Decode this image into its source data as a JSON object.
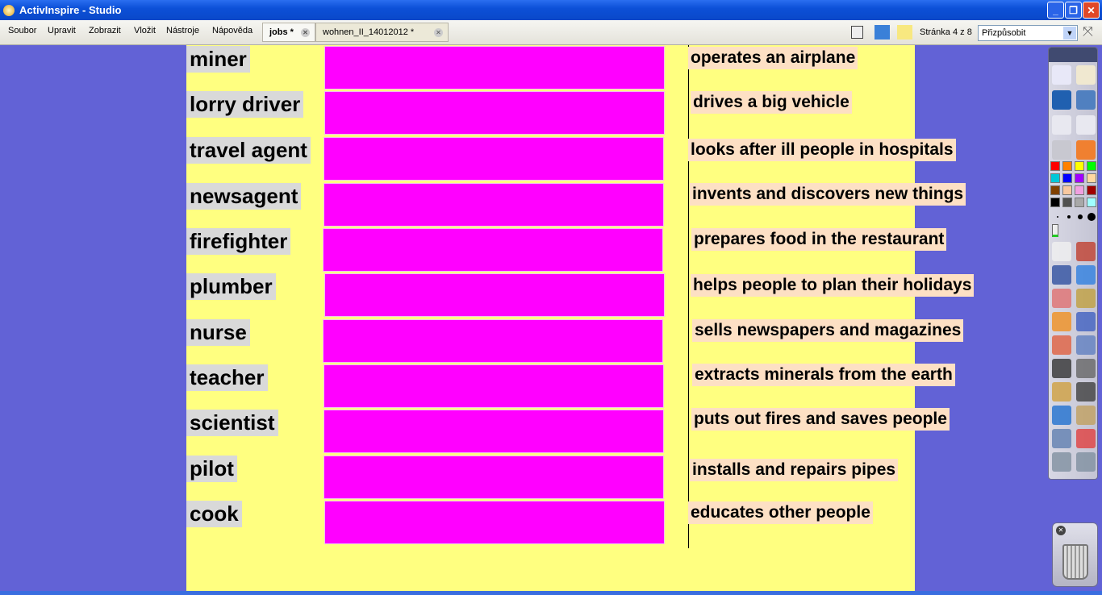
{
  "window": {
    "title": "ActivInspire - Studio"
  },
  "menu": [
    "Soubor",
    "Upravit",
    "Zobrazit",
    "Vložit",
    "Nástroje",
    "Nápověda"
  ],
  "tabs": [
    {
      "label": "jobs *",
      "active": true
    },
    {
      "label": "wohnen_II_14012012 *",
      "active": false
    }
  ],
  "toolbar": {
    "page_indicator": "Stránka 4 z 8",
    "zoom_value": "Přizpůsobit"
  },
  "words": [
    "miner",
    "lorry driver",
    "travel agent",
    "newsagent",
    "firefighter",
    "plumber",
    "nurse",
    "teacher",
    "scientist",
    "pilot",
    "cook"
  ],
  "definitions": [
    "operates an airplane",
    "drives a big vehicle",
    "looks after ill people in hospitals",
    "invents and discovers new things",
    "prepares food in the restaurant",
    "helps people to plan their holidays",
    "sells newspapers and magazines",
    "extracts minerals from the earth",
    "puts out fires and saves people",
    "installs and repairs pipes",
    "educates other people"
  ],
  "colors": {
    "page": "#ffff80",
    "cover_box": "#ff00ff",
    "word_bg": "#d9d9d9",
    "definition_bg": "#fde0c4",
    "canvas": "#6262d6"
  },
  "palette": [
    "#ff0000",
    "#ff8000",
    "#ffff00",
    "#00ff00",
    "#00c8d8",
    "#0000ff",
    "#a000ff",
    "#ffd8a0",
    "#804000",
    "#f8c8a0",
    "#f0a0e0",
    "#a00000",
    "#000000",
    "#505050",
    "#a8a8a8",
    "#a0ffff"
  ]
}
